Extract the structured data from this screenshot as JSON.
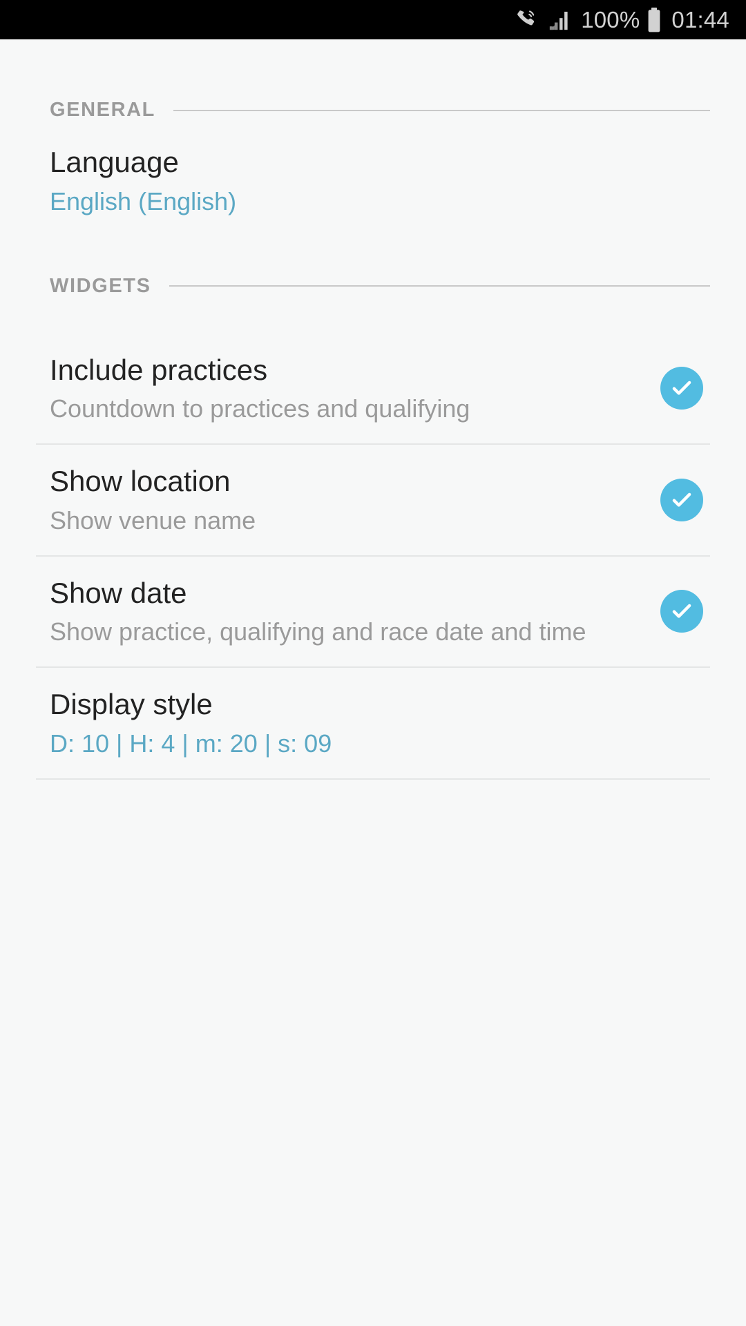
{
  "status_bar": {
    "icons": [
      {
        "name": "call-vibrate-icon",
        "glyph": "phone-vibrate"
      },
      {
        "name": "signal-bars-icon",
        "glyph": "signal"
      }
    ],
    "battery_percent": "100%",
    "battery_icon": "battery-full-icon",
    "time": "01:44",
    "background_color": "#000000",
    "text_color": "#d2d2d2"
  },
  "colors": {
    "page_background": "#f7f8f8",
    "accent_blue": "#5ba8c4",
    "checkbox_blue": "#52bce1",
    "title_text": "#232323",
    "subtitle_text": "#9a9a9a",
    "section_label": "#9a9a9a",
    "divider": "#e4e6e6",
    "rule": "#c9c9c9"
  },
  "sections": [
    {
      "id": "general",
      "header": "GENERAL",
      "rows": [
        {
          "id": "language",
          "title": "Language",
          "subtitle": "English (English)",
          "subtitle_style": "accent",
          "control": "none"
        }
      ]
    },
    {
      "id": "widgets",
      "header": "WIDGETS",
      "rows": [
        {
          "id": "include-practices",
          "title": "Include practices",
          "subtitle": "Countdown to practices and qualifying",
          "subtitle_style": "muted",
          "control": "checkbox",
          "checked": true
        },
        {
          "id": "show-location",
          "title": "Show location",
          "subtitle": "Show venue name",
          "subtitle_style": "muted",
          "control": "checkbox",
          "checked": true
        },
        {
          "id": "show-date",
          "title": "Show date",
          "subtitle": "Show practice, qualifying and race date and time",
          "subtitle_style": "muted",
          "control": "checkbox",
          "checked": true
        },
        {
          "id": "display-style",
          "title": "Display style",
          "subtitle": "D: 10 | H: 4 | m: 20 | s: 09",
          "subtitle_style": "accent",
          "control": "none"
        }
      ]
    }
  ]
}
